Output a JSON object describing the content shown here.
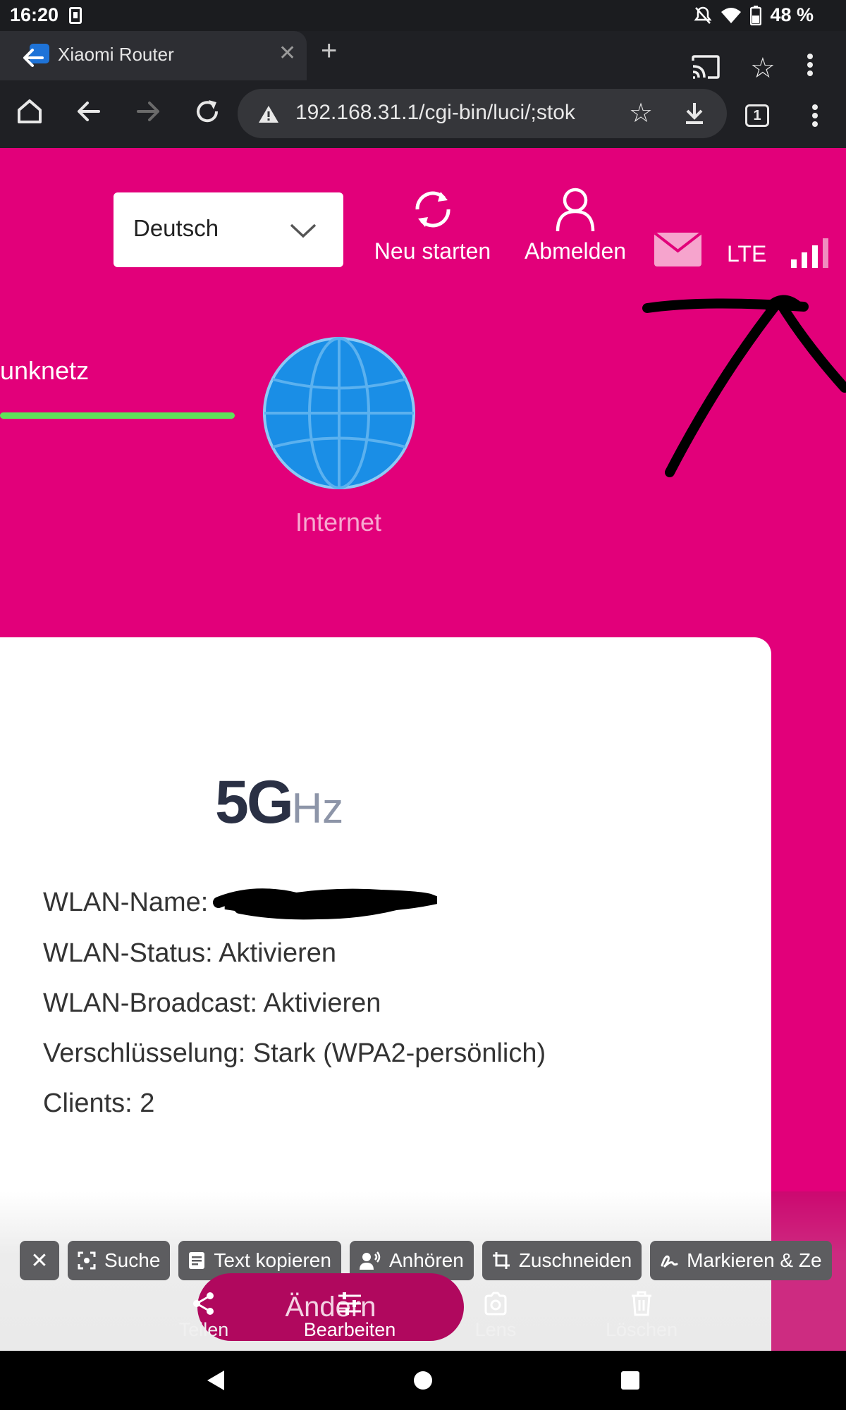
{
  "status_bar": {
    "time": "16:20",
    "battery_text": "48 %",
    "icons": [
      "sim-card-icon",
      "mute-icon",
      "wifi-icon",
      "battery-icon"
    ]
  },
  "browser": {
    "tab_title": "Xiaomi Router",
    "url": "192.168.31.1/cgi-bin/luci/;stok",
    "tab_count": "1"
  },
  "router_page": {
    "language": "Deutsch",
    "restart_label": "Neu starten",
    "logout_label": "Abmelden",
    "network_type": "LTE",
    "mobile_network_label": "unknetz",
    "internet_label": "Internet",
    "band_big": "5G",
    "band_unit": "Hz",
    "wlan_name_label": "WLAN-Name:",
    "wlan_status": "WLAN-Status: Aktivieren",
    "wlan_broadcast": "WLAN-Broadcast: Aktivieren",
    "encryption": "Verschlüsselung: Stark (WPA2-persönlich)",
    "clients": "Clients: 2"
  },
  "editor": {
    "chips": {
      "search": "Suche",
      "copy_text": "Text kopieren",
      "listen": "Anhören",
      "crop": "Zuschneiden",
      "markup": "Markieren & Ze"
    },
    "aendern_label": "Ändern",
    "actions": {
      "share": "Teilen",
      "edit": "Bearbeiten",
      "lens": "Lens",
      "delete": "Löschen"
    }
  },
  "colors": {
    "brand_magenta": "#e2007a",
    "connection_ok": "#5fe35a",
    "globe_blue": "#1a8ee6"
  }
}
